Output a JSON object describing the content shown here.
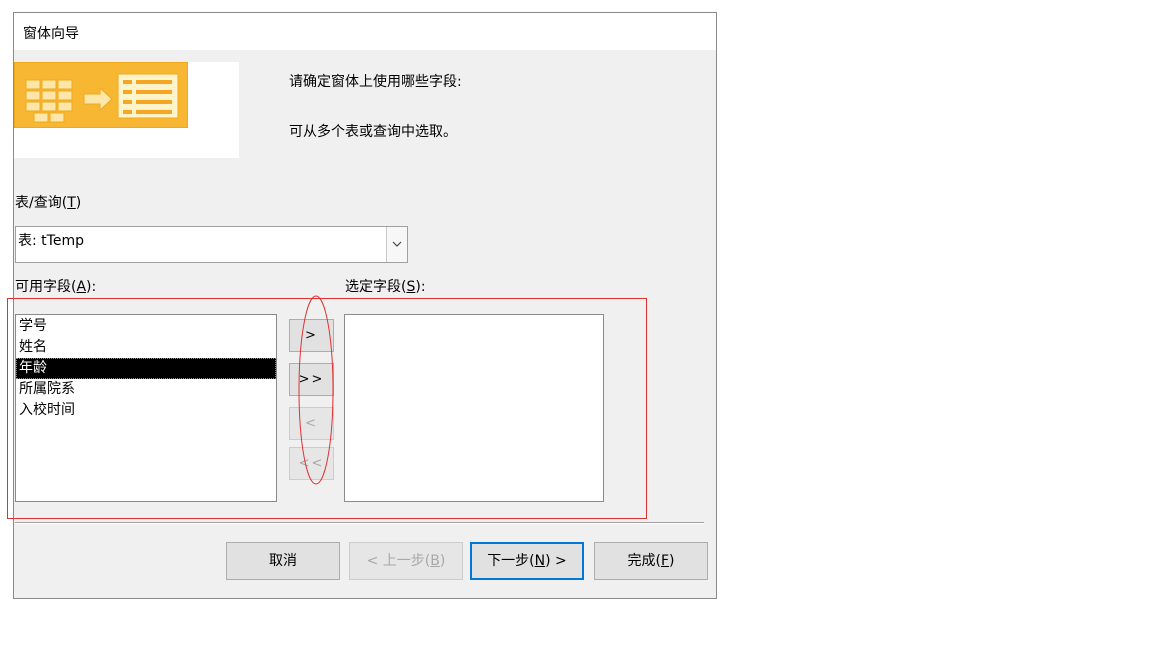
{
  "dialog": {
    "title": "窗体向导",
    "prompt_line1": "请确定窗体上使用哪些字段:",
    "prompt_line2": "可从多个表或查询中选取。"
  },
  "table_query": {
    "label": "表/查询(",
    "accesskey": "T",
    "label_end": ")",
    "selected_value": "表: tTemp"
  },
  "available_fields": {
    "label": "可用字段(",
    "accesskey": "A",
    "label_end": "):",
    "items": [
      "学号",
      "姓名",
      "年龄",
      "所属院系",
      "入校时间"
    ],
    "selected_index": 2
  },
  "selected_fields": {
    "label": "选定字段(",
    "accesskey": "S",
    "label_end": "):",
    "items": []
  },
  "move_buttons": {
    "add": ">",
    "add_all": ">>",
    "remove": "<",
    "remove_all": "<<"
  },
  "footer": {
    "cancel": "取消",
    "back_prefix": "< 上一步(",
    "back_key": "B",
    "back_suffix": ")",
    "next_prefix": "下一步(",
    "next_key": "N",
    "next_suffix": ") >",
    "finish_prefix": "完成(",
    "finish_key": "F",
    "finish_suffix": ")"
  },
  "colors": {
    "annotation": "#e03131",
    "default_button_border": "#0078d7",
    "banner_orange": "#f7b733"
  }
}
